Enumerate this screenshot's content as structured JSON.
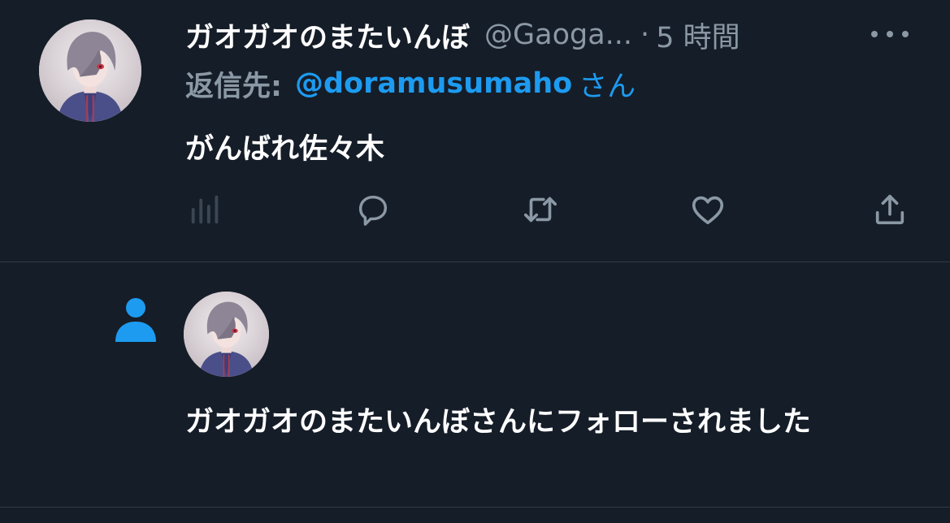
{
  "tweet": {
    "display_name": "ガオガオのまたいんぼ",
    "handle": "@Gaoga...",
    "separator": "·",
    "time": "5 時間",
    "reply_prefix": "返信先:",
    "reply_user": "@doramusumaho",
    "reply_suffix": "さん",
    "text": "がんばれ佐々木",
    "actions": [
      "analytics-icon",
      "reply-icon",
      "retweet-icon",
      "like-icon",
      "share-icon"
    ]
  },
  "notification": {
    "icon": "person-icon",
    "text": "ガオガオのまたいんぼさんにフォローされました"
  },
  "colors": {
    "background": "#151d28",
    "text": "#ffffff",
    "muted": "#8b98a5",
    "accent": "#1d9bf0",
    "divider": "#2f3b47"
  }
}
